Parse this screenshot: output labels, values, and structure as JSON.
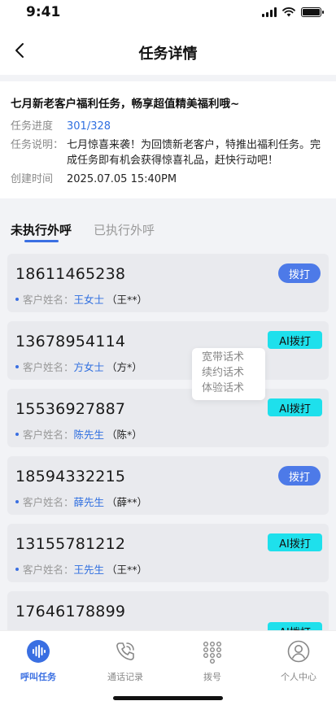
{
  "status": {
    "time": "9:41"
  },
  "nav": {
    "title": "任务详情"
  },
  "task": {
    "title": "七月新老客户福利任务，畅享超值精美福利哦~",
    "progress_label": "任务进度",
    "progress_value": "301/328",
    "desc_label": "任务说明：",
    "desc_value": "七月惊喜来袭！为回馈新老客户，特推出福利任务。完成任务即有机会获得惊喜礼品，赶快行动吧！",
    "created_label": "创建时间",
    "created_value": "2025.07.05 15:40PM"
  },
  "tabs": {
    "pending": "未执行外呼",
    "done": "已执行外呼"
  },
  "customer_label": "客户姓名：",
  "calls": [
    {
      "phone": "18611465238",
      "name": "王女士",
      "masked": "（王**）",
      "action": "拨打",
      "style": "dial"
    },
    {
      "phone": "13678954114",
      "name": "方女士",
      "masked": "（方*）",
      "action": "AI拨打",
      "style": "ai"
    },
    {
      "phone": "15536927887",
      "name": "陈先生",
      "masked": "（陈*）",
      "action": "AI拨打",
      "style": "ai"
    },
    {
      "phone": "18594332215",
      "name": "薛先生",
      "masked": "（薛**）",
      "action": "拨打",
      "style": "dial"
    },
    {
      "phone": "13155781212",
      "name": "王先生",
      "masked": "（王**）",
      "action": "AI拨打",
      "style": "ai"
    },
    {
      "phone": "17646178899",
      "name": "",
      "masked": "",
      "action": "AI拨打",
      "style": "ai"
    }
  ],
  "script_menu": [
    "宽带话术",
    "续约话术",
    "体验话术"
  ],
  "bottom_tabs": [
    {
      "label": "呼叫任务",
      "icon": "voice-wave-icon",
      "active": true
    },
    {
      "label": "通话记录",
      "icon": "phone-record-icon",
      "active": false
    },
    {
      "label": "拨号",
      "icon": "dialpad-icon",
      "active": false
    },
    {
      "label": "个人中心",
      "icon": "user-icon",
      "active": false
    }
  ],
  "colors": {
    "accent": "#3a6fe2",
    "ai_button": "#1ee0ec",
    "dial_button": "#4d7ae8"
  }
}
